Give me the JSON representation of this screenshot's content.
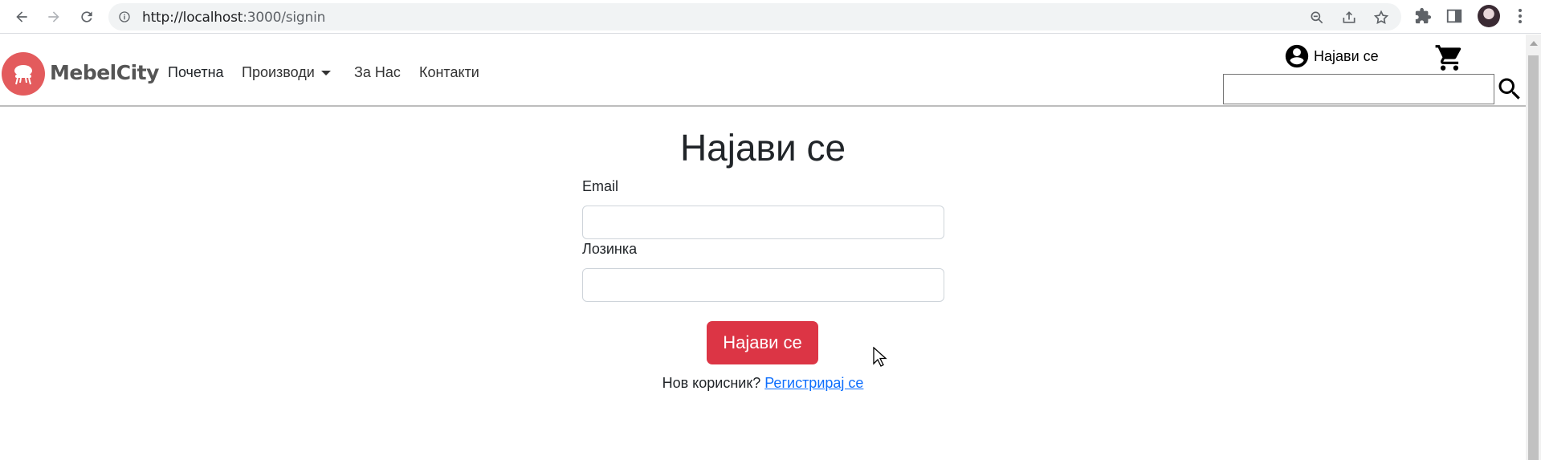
{
  "browser": {
    "url_host": "http://localhost",
    "url_path": ":3000/signin"
  },
  "header": {
    "logo_text": "MebelCity",
    "nav": {
      "home": "Почетна",
      "products": "Производи",
      "about": "За Нас",
      "contacts": "Контакти"
    },
    "login_label": "Најави се",
    "search_value": ""
  },
  "form": {
    "title": "Најави се",
    "email_label": "Email",
    "email_value": "",
    "password_label": "Лозинка",
    "password_value": "",
    "submit_label": "Најави се",
    "new_user_text": "Нов корисник?",
    "register_link": "Регистрирај се"
  },
  "colors": {
    "primary_button": "#dc3545",
    "link": "#0d6efd",
    "logo": "#e35b5d"
  }
}
